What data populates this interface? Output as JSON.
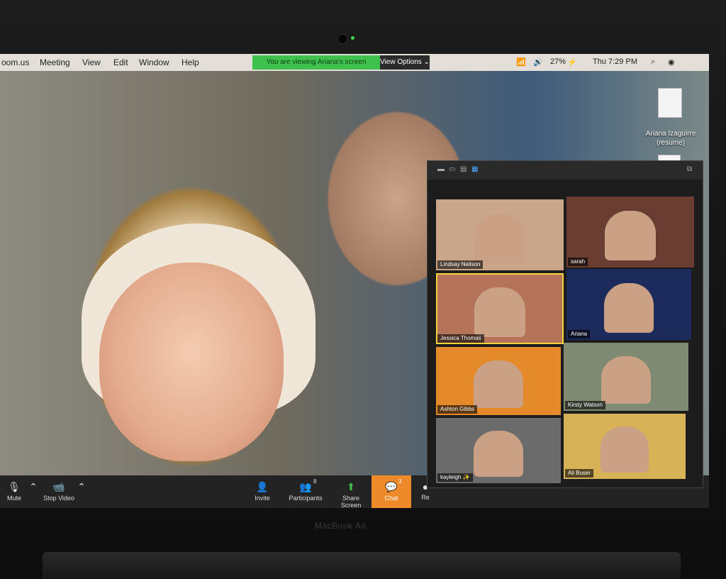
{
  "menubar": {
    "app": "oom.us",
    "items": [
      "Meeting",
      "View",
      "Edit",
      "Window",
      "Help"
    ],
    "share_banner": "You are viewing Ariana's screen",
    "view_options": "View Options ⌄",
    "battery": "27%",
    "clock": "Thu 7:29 PM"
  },
  "desktop": {
    "file_label_line1": "Ariana Izaguirre",
    "file_label_line2": "(resume)"
  },
  "toolbar": {
    "mute": "Mute",
    "stop_video": "Stop Video",
    "invite": "Invite",
    "participants": "Participants",
    "participants_count": "8",
    "share_screen": "Share Screen",
    "chat": "Chat",
    "chat_count": "3",
    "record_partial": "Re"
  },
  "gallery": {
    "tiles": [
      {
        "name": "Lindsay Neilson",
        "bg": "#c9a58a"
      },
      {
        "name": "sarah",
        "bg": "#6a3d32"
      },
      {
        "name": "Jessica Thomas",
        "bg": "#b5745a"
      },
      {
        "name": "Ariana",
        "bg": "#1d2a5c"
      },
      {
        "name": "Ashton Gibbs",
        "bg": "#e58a2a"
      },
      {
        "name": "Kirsty Watson",
        "bg": "#7f8a72"
      },
      {
        "name": "kayleigh ✨",
        "bg": "#6b6b6b"
      },
      {
        "name": "Ali Buser",
        "bg": "#d8b256"
      }
    ]
  },
  "device_label": "MacBook Air",
  "colors": {
    "share_banner_bg": "#3fc24d",
    "chat_button_bg": "#ee8a2a",
    "active_speaker_outline": "#f2d43a"
  }
}
